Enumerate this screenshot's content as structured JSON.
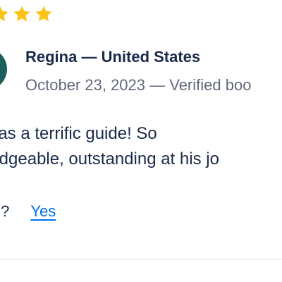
{
  "review": {
    "rating_stars_visible": 3,
    "star_color": "#fcc214",
    "avatar_color": "#1d5f5a",
    "reviewer_line": "Regina — United States",
    "meta_line": "October 23, 2023 — Verified boo",
    "text_line_1": "was a terrific guide! So",
    "text_line_2": "ledgeable, outstanding at his jo",
    "helpful_label": "ul?",
    "helpful_yes": "Yes"
  },
  "colors": {
    "text_primary": "#1a2b49",
    "text_secondary": "#63687a",
    "link": "#0071eb",
    "divider": "#dcdfe4"
  }
}
